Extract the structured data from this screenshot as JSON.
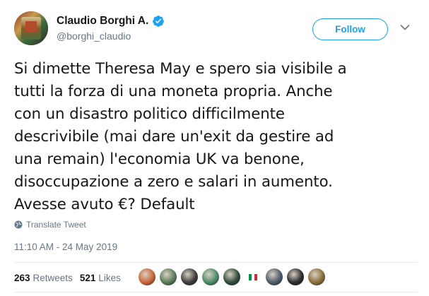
{
  "user": {
    "display_name": "Claudio Borghi A.",
    "handle": "@borghi_claudio",
    "verified": true
  },
  "follow_button": {
    "label": "Follow"
  },
  "tweet": {
    "text": "Si dimette Theresa May e spero sia visibile a\ntutti la forza di una moneta propria. Anche\ncon un disastro politico difficilmente\ndescrivibile (mai dare un'exit da gestire ad\nuna remain) l'economia UK va benone,\ndisoccupazione a zero e salari in aumento.\nAvesse avuto €? Default",
    "translate_label": "Translate Tweet",
    "timestamp": "11:10 AM - 24 May 2019"
  },
  "stats": {
    "retweets_count": "263",
    "retweets_label": "Retweets",
    "likes_count": "521",
    "likes_label": "Likes"
  },
  "likers": [
    {
      "icon": "avatar-1",
      "color": "#c8643a"
    },
    {
      "icon": "avatar-2",
      "color": "#5a7a5a"
    },
    {
      "icon": "avatar-3",
      "color": "#3a3a3a"
    },
    {
      "icon": "avatar-4",
      "color": "#4a8a6a"
    },
    {
      "icon": "avatar-5",
      "color": "#2e4a3a"
    },
    {
      "icon": "italy-flag-icon",
      "color": "#009246"
    },
    {
      "icon": "avatar-7",
      "color": "#4a5a6a"
    },
    {
      "icon": "avatar-8",
      "color": "#2a2a2a"
    },
    {
      "icon": "avatar-9",
      "color": "#8a6a3a"
    }
  ],
  "colors": {
    "accent": "#1da1f2",
    "secondary_text": "#657786",
    "primary_text": "#14171a",
    "divider": "#e6ecf0"
  }
}
